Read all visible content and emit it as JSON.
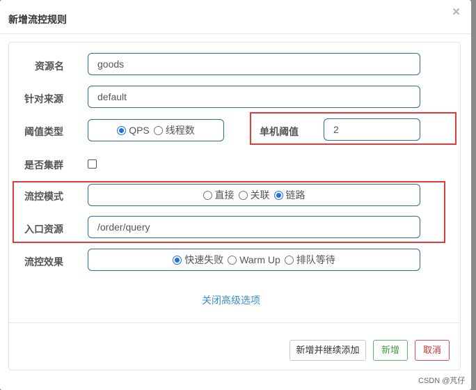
{
  "dialog": {
    "title": "新增流控规则",
    "close_icon": "×"
  },
  "form": {
    "resource": {
      "label": "资源名",
      "value": "goods"
    },
    "origin": {
      "label": "针对来源",
      "value": "default"
    },
    "threshold_type": {
      "label": "阈值类型",
      "options": [
        "QPS",
        "线程数"
      ],
      "selected": "QPS"
    },
    "single_threshold": {
      "label": "单机阈值",
      "value": "2"
    },
    "cluster": {
      "label": "是否集群",
      "checked": false
    },
    "flow_mode": {
      "label": "流控模式",
      "options": [
        "直接",
        "关联",
        "链路"
      ],
      "selected": "链路"
    },
    "entry_resource": {
      "label": "入口资源",
      "value": "/order/query"
    },
    "flow_effect": {
      "label": "流控效果",
      "options": [
        "快速失败",
        "Warm Up",
        "排队等待"
      ],
      "selected": "快速失败"
    },
    "advanced_link": "关闭高级选项"
  },
  "buttons": {
    "add_continue": "新增并继续添加",
    "add": "新增",
    "cancel": "取消"
  },
  "watermark": "CSDN @芃仔",
  "colors": {
    "highlight_frame": "#e03a3a",
    "link": "#3a8fc9",
    "radio_selected": "#1a73e8"
  }
}
